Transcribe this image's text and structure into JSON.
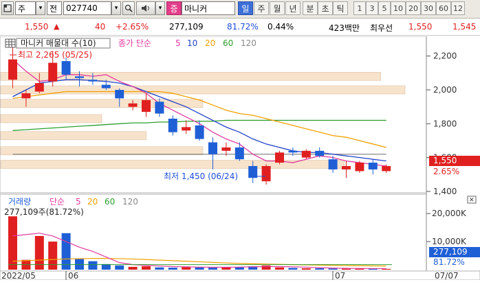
{
  "toolbar": {
    "market_label": "주",
    "dropdown_glyph": "▾",
    "prefix_label": "전",
    "code_value": "027740",
    "search_icon": "search-icon",
    "sound_icon": "speaker-icon",
    "type_badge": "증",
    "stock_name": "마니커",
    "period_tabs": [
      "일",
      "주",
      "월",
      "년",
      "분",
      "초",
      "틱"
    ],
    "active_period": "일",
    "number_tabs": [
      "1",
      "3",
      "5",
      "10",
      "20",
      "30",
      "60",
      "12"
    ]
  },
  "quote": {
    "price": "1,550",
    "change_arrow": "▲",
    "change": "40",
    "change_pct": "+2.65%",
    "volume": "277,109",
    "volume_ratio": "81.72%",
    "turnover": "0.44%",
    "amount": "423백만",
    "priority_label": "최우선",
    "ask": "1,550",
    "bid": "1,545"
  },
  "price_panel": {
    "title": "마니커 매물대 수(10)",
    "legend_prefix": "종가 단순",
    "ma_labels": [
      "5",
      "10",
      "20",
      "60",
      "120"
    ],
    "high_note": "최고 2,265 (05/25)",
    "low_note": "최저 1,450 (06/24)",
    "cur_price_tag": "1,550",
    "cur_pct_tag": "2.65%"
  },
  "volume_panel": {
    "title": "거래량",
    "legend_prefix": "단순",
    "ma_labels": [
      "5",
      "20",
      "60",
      "120"
    ],
    "vol_note": "277,109주(81.72%)",
    "cur_vol_tag": "277,109",
    "cur_pct_tag": "81.72%"
  },
  "x_labels": {
    "left": "2022/05",
    "mid": "06",
    "right": "07",
    "right_axis": "07/07"
  },
  "colors": {
    "up": "#e02020",
    "down": "#1f5fd6",
    "ma5": "#e23aa0",
    "ma10": "#2040c8",
    "ma20": "#f0a000",
    "ma60": "#2e9e2e",
    "ma120": "#888888",
    "volume_profile": "#f7e3cc"
  },
  "chart_data": [
    {
      "type": "candlestick",
      "title": "마니커 매물대 수(10)",
      "ylim": [
        1400,
        2300
      ],
      "y_ticks": [
        1400,
        1600,
        1800,
        2000,
        2200
      ],
      "y_tick_labels": [
        "1,400",
        "1,600",
        "1,800",
        "2,000",
        "2,200"
      ],
      "candles": [
        {
          "o": 2060,
          "h": 2265,
          "l": 2010,
          "c": 2180
        },
        {
          "o": 1950,
          "h": 2000,
          "l": 1900,
          "c": 1980
        },
        {
          "o": 1990,
          "h": 2100,
          "l": 1980,
          "c": 2040
        },
        {
          "o": 2050,
          "h": 2230,
          "l": 2020,
          "c": 2160
        },
        {
          "o": 2170,
          "h": 2190,
          "l": 2060,
          "c": 2090
        },
        {
          "o": 2080,
          "h": 2110,
          "l": 2020,
          "c": 2070
        },
        {
          "o": 2060,
          "h": 2100,
          "l": 2030,
          "c": 2050
        },
        {
          "o": 2030,
          "h": 2060,
          "l": 2000,
          "c": 2010
        },
        {
          "o": 2000,
          "h": 2010,
          "l": 1900,
          "c": 1950
        },
        {
          "o": 1900,
          "h": 1940,
          "l": 1880,
          "c": 1920
        },
        {
          "o": 1870,
          "h": 1980,
          "l": 1840,
          "c": 1940
        },
        {
          "o": 1930,
          "h": 1950,
          "l": 1840,
          "c": 1860
        },
        {
          "o": 1830,
          "h": 1850,
          "l": 1730,
          "c": 1750
        },
        {
          "o": 1760,
          "h": 1820,
          "l": 1740,
          "c": 1780
        },
        {
          "o": 1790,
          "h": 1820,
          "l": 1700,
          "c": 1710
        },
        {
          "o": 1690,
          "h": 1720,
          "l": 1530,
          "c": 1620
        },
        {
          "o": 1640,
          "h": 1690,
          "l": 1610,
          "c": 1660
        },
        {
          "o": 1660,
          "h": 1690,
          "l": 1580,
          "c": 1590
        },
        {
          "o": 1550,
          "h": 1580,
          "l": 1450,
          "c": 1480
        },
        {
          "o": 1460,
          "h": 1560,
          "l": 1440,
          "c": 1550
        },
        {
          "o": 1570,
          "h": 1640,
          "l": 1560,
          "c": 1630
        },
        {
          "o": 1640,
          "h": 1660,
          "l": 1610,
          "c": 1630
        },
        {
          "o": 1600,
          "h": 1650,
          "l": 1590,
          "c": 1640
        },
        {
          "o": 1640,
          "h": 1660,
          "l": 1600,
          "c": 1610
        },
        {
          "o": 1590,
          "h": 1610,
          "l": 1510,
          "c": 1530
        },
        {
          "o": 1530,
          "h": 1580,
          "l": 1480,
          "c": 1550
        },
        {
          "o": 1520,
          "h": 1580,
          "l": 1510,
          "c": 1570
        },
        {
          "o": 1570,
          "h": 1590,
          "l": 1500,
          "c": 1530
        },
        {
          "o": 1520,
          "h": 1560,
          "l": 1510,
          "c": 1550
        }
      ],
      "ma5": [
        2180,
        2110,
        2050,
        2060,
        2090,
        2090,
        2080,
        2090,
        2050,
        2020,
        1980,
        1920,
        1880,
        1840,
        1800,
        1750,
        1710,
        1680,
        1620,
        1580,
        1580,
        1570,
        1590,
        1610,
        1600,
        1580,
        1570,
        1560,
        1550
      ],
      "ma10": [
        1960,
        2000,
        2040,
        2050,
        2060,
        2060,
        2055,
        2050,
        2040,
        2020,
        1990,
        1960,
        1930,
        1900,
        1860,
        1820,
        1780,
        1750,
        1710,
        1680,
        1660,
        1640,
        1630,
        1630,
        1620,
        1610,
        1600,
        1590,
        1580
      ],
      "ma20": [
        1950,
        1960,
        1970,
        1980,
        1990,
        1990,
        1990,
        1990,
        1990,
        1990,
        1990,
        1990,
        1980,
        1960,
        1940,
        1910,
        1880,
        1860,
        1850,
        1830,
        1810,
        1790,
        1770,
        1750,
        1730,
        1720,
        1700,
        1680,
        1660
      ],
      "ma60": [
        1760,
        1765,
        1770,
        1775,
        1780,
        1785,
        1790,
        1795,
        1800,
        1805,
        1805,
        1810,
        1810,
        1815,
        1815,
        1815,
        1820,
        1820,
        1820,
        1820,
        1820,
        1820,
        1820,
        1820,
        1820,
        1820,
        1820,
        1820,
        1820
      ],
      "ma120": [
        1620,
        1620,
        1620,
        1620,
        1620,
        1620,
        1620,
        1620,
        1620,
        1620,
        1620,
        1620,
        1620,
        1620,
        1620,
        1620,
        1620,
        1620,
        1620,
        1620,
        1620,
        1620,
        1620,
        1620,
        1620,
        1620,
        1620,
        1620,
        1620
      ],
      "volume_profile": [
        {
          "price": 1560,
          "weight": 0.85
        },
        {
          "price": 1640,
          "weight": 0.5
        },
        {
          "price": 1730,
          "weight": 0.36
        },
        {
          "price": 1830,
          "weight": 0.25
        },
        {
          "price": 1920,
          "weight": 0.5
        },
        {
          "price": 2000,
          "weight": 1.0
        },
        {
          "price": 2080,
          "weight": 0.94
        }
      ]
    },
    {
      "type": "bar",
      "title": "거래량",
      "ylim": [
        0,
        22000
      ],
      "y_ticks": [
        10000,
        20000
      ],
      "y_tick_labels": [
        "10,000K",
        "20,000K"
      ],
      "values": [
        19000,
        3500,
        12000,
        10000,
        13000,
        4000,
        3000,
        2000,
        1500,
        1000,
        1200,
        800,
        700,
        900,
        800,
        700,
        900,
        1000,
        1200,
        1500,
        800,
        600,
        500,
        500,
        400,
        400,
        350,
        300,
        280
      ],
      "ma5_vol": [
        12000,
        12500,
        13000,
        12000,
        10000,
        8000,
        6500,
        4500,
        2500,
        1800,
        1500,
        1300,
        1100,
        1000,
        900,
        850,
        850,
        900,
        1000,
        1100,
        1100,
        1000,
        900,
        700,
        550,
        450,
        420,
        380,
        350
      ],
      "ma20_vol": [
        3000,
        3200,
        3400,
        3600,
        3800,
        3900,
        4000,
        4000,
        3900,
        3800,
        3600,
        3400,
        3200,
        3000,
        2800,
        2600,
        2400,
        2200,
        2100,
        2000,
        1900,
        1800,
        1700,
        1600,
        1500,
        1450,
        1400,
        1350,
        1300
      ]
    }
  ]
}
